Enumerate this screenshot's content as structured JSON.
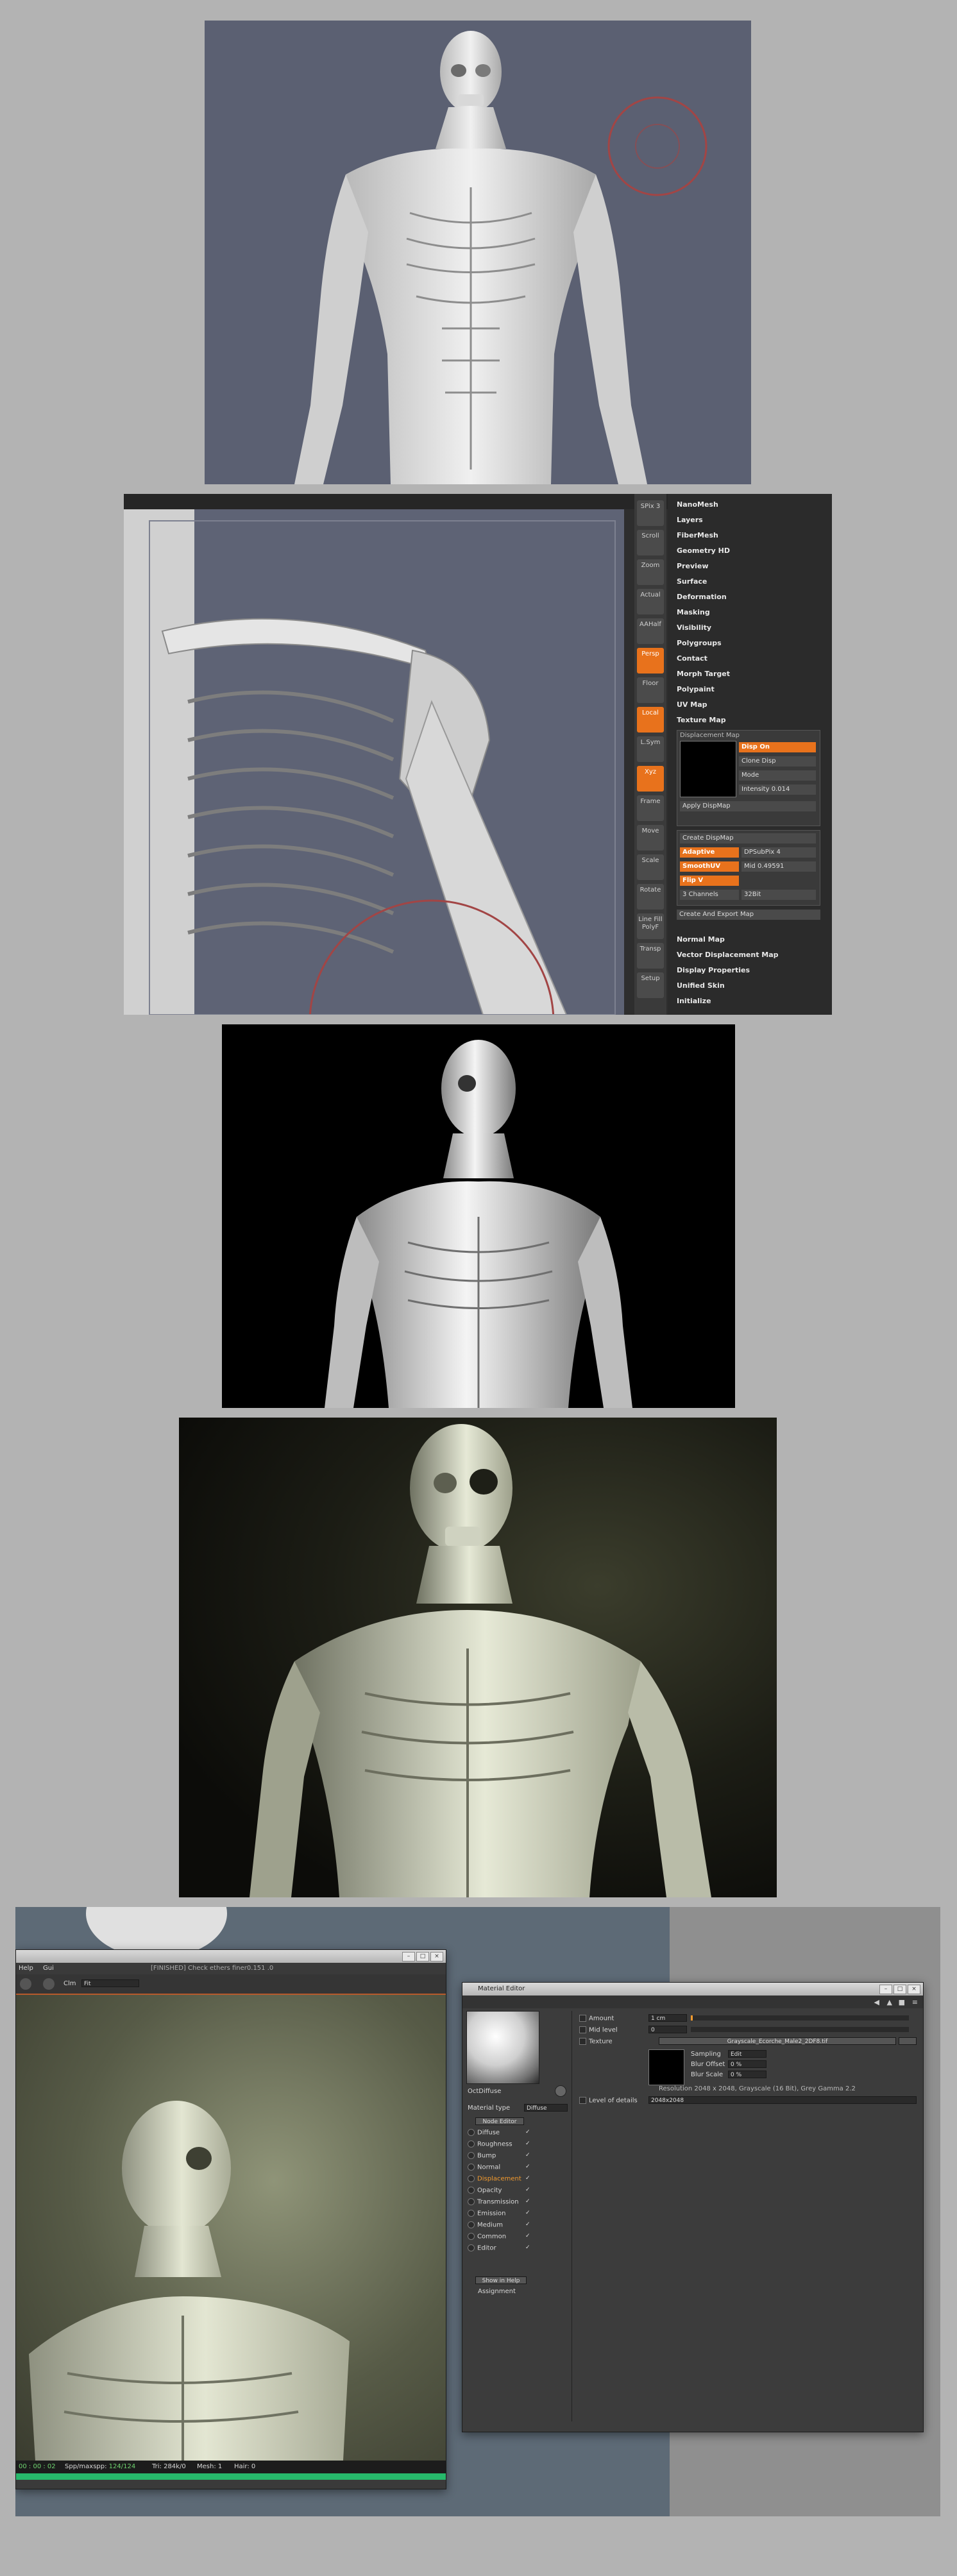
{
  "zbrush": {
    "shelf": [
      {
        "label": "SPix 3"
      },
      {
        "label": "Scroll"
      },
      {
        "label": "Zoom"
      },
      {
        "label": "Actual"
      },
      {
        "label": "AAHalf"
      },
      {
        "label": "Persp"
      },
      {
        "label": "Floor"
      },
      {
        "label": "Local"
      },
      {
        "label": "L.Sym"
      },
      {
        "label": "Xyz"
      },
      {
        "label": "Frame"
      },
      {
        "label": "Move"
      },
      {
        "label": "Scale"
      },
      {
        "label": "Rotate"
      },
      {
        "label": "Line Fill PolyF"
      },
      {
        "label": "Transp"
      },
      {
        "label": "Setup"
      }
    ],
    "menu_top": [
      "NanoMesh",
      "Layers",
      "FiberMesh",
      "Geometry HD",
      "Preview",
      "Surface",
      "Deformation",
      "Masking",
      "Visibility",
      "Polygroups",
      "Contact",
      "Morph Target",
      "Polypaint",
      "UV Map",
      "Texture Map"
    ],
    "displacement": {
      "header": "Displacement Map",
      "disp_on": "Disp On",
      "clone_disp": "Clone Disp",
      "mode": "Mode",
      "intensity_label": "Intensity",
      "intensity_value": "0.014",
      "apply": "Apply DispMap",
      "create": "Create DispMap",
      "adaptive": "Adaptive",
      "dpsubpix_label": "DPSubPix",
      "dpsubpix_value": "4",
      "smoothuv": "SmoothUV",
      "mid_label": "Mid",
      "mid_value": "0.49591",
      "flip_v": "Flip V",
      "channels_label": "3 Channels",
      "channels_value": "32Bit",
      "export": "Create And Export Map"
    },
    "menu_bottom": [
      "Normal Map",
      "Vector Displacement Map",
      "Display Properties",
      "Unified Skin",
      "Initialize"
    ]
  },
  "c4d": {
    "render_window": {
      "title": "[FINISHED] Check ethers finer0.151 .0",
      "menu": [
        "Help",
        "Gui"
      ],
      "clm_label": "Clm",
      "clm_value": "Fit",
      "status_time": "00 : 00 : 02",
      "status_spp_label": "Spp/maxspp:",
      "status_spp_value": "124/124",
      "status_tri": "Tri: 284k/0",
      "status_mesh": "Mesh: 1",
      "status_hair": "Hair: 0"
    },
    "material_editor": {
      "title": "Material Editor",
      "preview_name": "OctDiffuse",
      "material_type_label": "Material type",
      "material_type_value": "Diffuse",
      "node_editor": "Node Editor",
      "channels": [
        {
          "label": "Diffuse",
          "checked": true,
          "active": false
        },
        {
          "label": "Roughness",
          "checked": true,
          "active": false
        },
        {
          "label": "Bump",
          "checked": true,
          "active": false
        },
        {
          "label": "Normal",
          "checked": true,
          "active": false
        },
        {
          "label": "Displacement",
          "checked": true,
          "active": true
        },
        {
          "label": "Opacity",
          "checked": true,
          "active": false
        },
        {
          "label": "Transmission",
          "checked": true,
          "active": false
        },
        {
          "label": "Emission",
          "checked": true,
          "active": false
        },
        {
          "label": "Medium",
          "checked": true,
          "active": false
        },
        {
          "label": "Common",
          "checked": true,
          "active": false
        },
        {
          "label": "Editor",
          "checked": true,
          "active": false
        }
      ],
      "show_in_help": "Show in Help",
      "assignment": "Assignment",
      "amount_label": "Amount",
      "amount_value": "1 cm",
      "mid_level_label": "Mid level",
      "mid_level_value": "0",
      "texture_label": "Texture",
      "texture_value": "Grayscale_Ecorche_Male2_2DF8.tif",
      "sampling_label": "Sampling",
      "sampling_value": "Edit",
      "blur_offset_label": "Blur Offset",
      "blur_offset_value": "0 %",
      "blur_scale_label": "Blur Scale",
      "blur_scale_value": "0 %",
      "resolution": "Resolution 2048 x 2048, Grayscale (16 Bit), Grey Gamma 2.2",
      "lod_label": "Level of details",
      "lod_value": "2048x2048"
    }
  },
  "colors": {
    "zbrush_orange": "#e8721c",
    "c4d_active": "#f29a2e"
  }
}
